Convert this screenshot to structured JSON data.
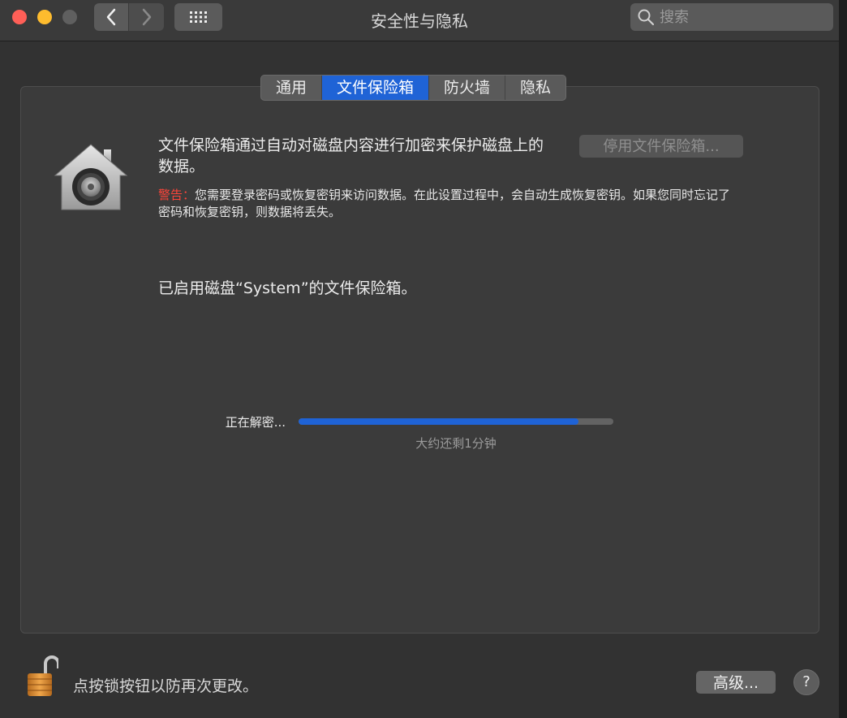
{
  "window": {
    "title": "安全性与隐私"
  },
  "search": {
    "placeholder": "搜索"
  },
  "tabs": [
    {
      "label": "通用",
      "active": false
    },
    {
      "label": "文件保险箱",
      "active": true
    },
    {
      "label": "防火墙",
      "active": false
    },
    {
      "label": "隐私",
      "active": false
    }
  ],
  "filevault": {
    "description": "文件保险箱通过自动对磁盘内容进行加密来保护磁盘上的数据。",
    "warning_label": "警告：",
    "warning_text": "您需要登录密码或恢复密钥来访问数据。在此设置过程中，会自动生成恢复密钥。如果您同时忘记了密码和恢复密钥，则数据将丢失。",
    "disable_button": "停用文件保险箱...",
    "status": "已启用磁盘“System”的文件保险箱。",
    "progress_label": "正在解密...",
    "progress_fraction": 0.89,
    "time_remaining": "大约还剩1分钟"
  },
  "footer": {
    "lock_text": "点按锁按钮以防再次更改。",
    "advanced_button": "高级...",
    "help_button": "?"
  },
  "colors": {
    "accent": "#1f63d6",
    "warning": "#ff453a"
  }
}
